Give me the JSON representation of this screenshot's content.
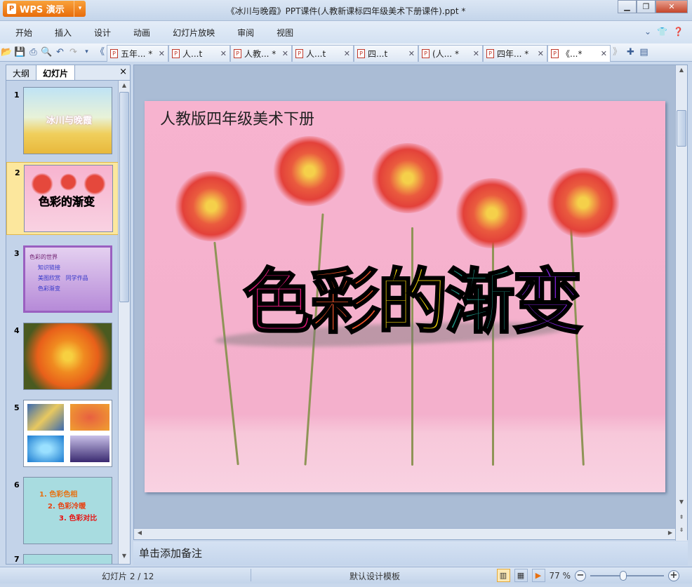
{
  "app": {
    "button_label": "WPS 演示",
    "window_title": "《冰川与晚霞》PPT课件(人教新课标四年级美术下册课件).ppt *"
  },
  "menu": [
    "开始",
    "插入",
    "设计",
    "动画",
    "幻灯片放映",
    "审阅",
    "视图"
  ],
  "doc_tabs": [
    {
      "label": "五年... *"
    },
    {
      "label": "人...t"
    },
    {
      "label": "人教... *"
    },
    {
      "label": "人...t"
    },
    {
      "label": "四...t"
    },
    {
      "label": "(人... *"
    },
    {
      "label": "四年... *"
    },
    {
      "label": "《...*"
    }
  ],
  "panel": {
    "tab_outline": "大纲",
    "tab_slides": "幻灯片",
    "close": "×"
  },
  "thumbnails": [
    {
      "num": "1",
      "text": "冰川与晚霞"
    },
    {
      "num": "2",
      "text": "色彩的渐变"
    },
    {
      "num": "3",
      "lines": [
        "色彩的世界",
        "知识链接",
        "美图欣赏",
        "同学作品",
        "色彩渐变"
      ]
    },
    {
      "num": "4"
    },
    {
      "num": "5"
    },
    {
      "num": "6",
      "lines": [
        "1. 色彩色相",
        "2. 色彩冷暖",
        "3. 色彩对比"
      ]
    },
    {
      "num": "7"
    }
  ],
  "slide": {
    "subtitle": "人教版四年级美术下册",
    "title_chars": [
      "色",
      "彩",
      "的",
      "渐",
      "变"
    ],
    "title_colors": [
      "#e0187a",
      "#f0542a",
      "#f2d40c",
      "#1f9a8a",
      "#7a1fd0"
    ]
  },
  "notes_placeholder": "单击添加备注",
  "status": {
    "slide_indicator": "幻灯片 2 / 12",
    "template": "默认设计模板",
    "zoom": "77 %",
    "zoom_fraction": 0.4
  }
}
